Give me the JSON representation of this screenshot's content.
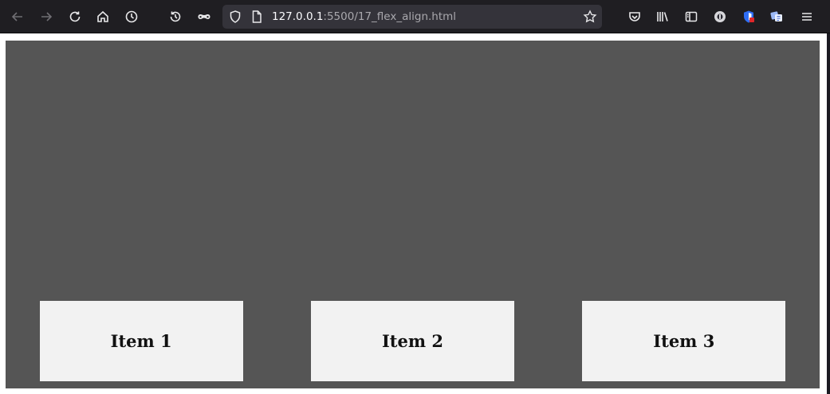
{
  "browser": {
    "url_host": "127.0.0.1",
    "url_rest": ":5500/17_flex_align.html",
    "toolbar_icons": [
      "back-icon",
      "forward-icon",
      "reload-icon",
      "home-icon",
      "history-icon",
      "forget-icon",
      "private-mask-icon",
      "shield-icon",
      "page-icon",
      "bookmark-star-icon",
      "pocket-icon",
      "library-icon",
      "sidebar-icon",
      "extension-icon",
      "extension-icon-2",
      "extension-icon-3",
      "menu-icon"
    ]
  },
  "page": {
    "container_color": "#555555",
    "item_color": "#f2f2f2",
    "items": [
      {
        "label": "Item 1"
      },
      {
        "label": "Item 2"
      },
      {
        "label": "Item 3"
      }
    ]
  }
}
